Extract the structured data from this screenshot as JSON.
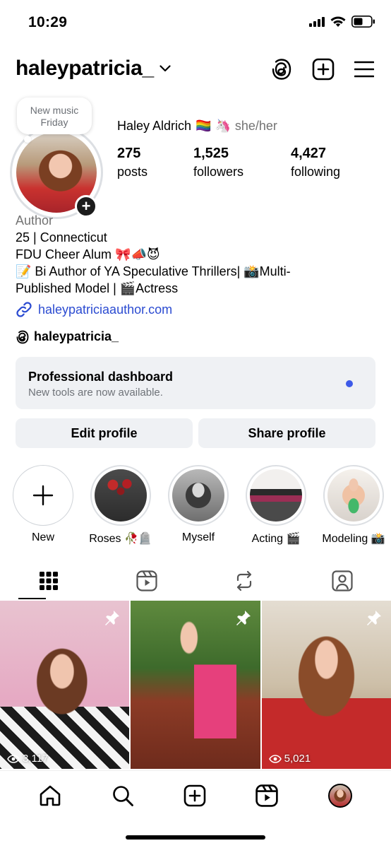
{
  "status_bar": {
    "time": "10:29"
  },
  "header": {
    "username": "haleypatricia_"
  },
  "note": {
    "line1": "New music",
    "line2": "Friday"
  },
  "profile": {
    "display_name": "Haley Aldrich",
    "name_emoji": "🏳️‍🌈 🦄",
    "pronouns": "she/her",
    "stats": [
      {
        "num": "275",
        "label": "posts"
      },
      {
        "num": "1,525",
        "label": "followers"
      },
      {
        "num": "4,427",
        "label": "following"
      }
    ]
  },
  "bio": {
    "category": "Author",
    "line1": "25 | Connecticut",
    "line2": "FDU Cheer Alum 🎀📣😈",
    "line3": "📝 Bi Author of YA Speculative Thrillers| 📸Multi-",
    "line4": "Published Model | 🎬Actress",
    "link": "haleypatriciaauthor.com",
    "threads_handle": "haleypatricia_"
  },
  "dashboard": {
    "title": "Professional dashboard",
    "subtitle": "New tools are now available."
  },
  "buttons": {
    "edit": "Edit profile",
    "share": "Share profile"
  },
  "highlights": [
    {
      "label": "New"
    },
    {
      "label": "Roses 🥀🪦"
    },
    {
      "label": "Myself"
    },
    {
      "label": "Acting 🎬"
    },
    {
      "label": "Modeling 📸"
    }
  ],
  "posts": [
    {
      "views": "3,117"
    },
    {
      "views": ""
    },
    {
      "views": "5,021"
    }
  ],
  "colors": {
    "link": "#2b4bd1",
    "dashboard_dot": "#3d5ae8",
    "button_bg": "#eff1f4"
  }
}
